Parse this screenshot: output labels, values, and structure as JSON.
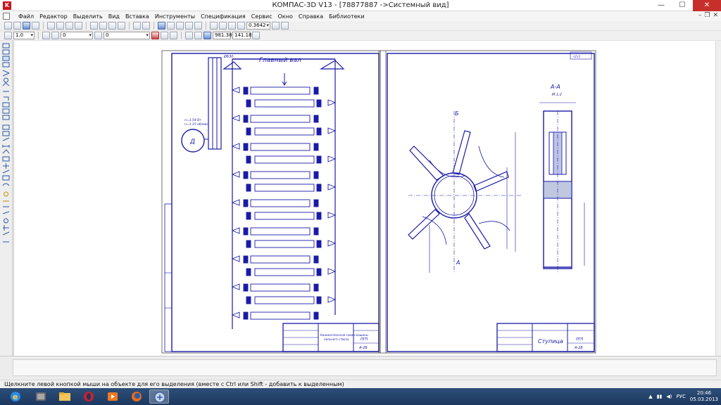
{
  "window": {
    "title": "КОМПАС-3D V13 - [78877887 ->Системный вид]",
    "minimize": "—",
    "maximize": "☐",
    "close": "✕",
    "app_icon": "K"
  },
  "menu": {
    "items": [
      "Файл",
      "Редактор",
      "Выделить",
      "Вид",
      "Вставка",
      "Инструменты",
      "Спецификация",
      "Сервис",
      "Окно",
      "Справка",
      "Библиотеки"
    ],
    "doc_controls": [
      "–",
      "❐",
      "✕"
    ]
  },
  "toolbar1": {
    "zoom_value": "0.3642"
  },
  "toolbar2": {
    "scale_value": "1.0",
    "style_value": "0",
    "layer_value": "0",
    "coord_x": "981.38",
    "coord_y": "141.18"
  },
  "drawing_left": {
    "title": "Главный вал",
    "labels": [
      "Ø630",
      "Д",
      "n=3.54 Вт",
      "n=1.15 об/мин"
    ],
    "stamp_title_1": "Кинематическая схема машины",
    "stamp_title_2": "пильного ствола",
    "stamp_code_1": "ПГП",
    "stamp_code_2": "А-2Б"
  },
  "drawing_right": {
    "section_label": "А-А",
    "section_scale": "М 1:2",
    "mark_top": "Б",
    "mark_bottom": "А",
    "stamp_title": "Ступица",
    "stamp_code_1": "ПГП",
    "stamp_code_2": "А-2Б",
    "roughness": "√(√)"
  },
  "status": {
    "hint": "Щелкните левой кнопкой мыши на объекте для его выделения (вместе с Ctrl или Shift - добавить к выделенным)"
  },
  "taskbar": {
    "lang": "РУС",
    "time": "20:46",
    "date": "05.03.2013"
  },
  "colors": {
    "drawing_blue": "#1a1aa8",
    "title_red": "#c8161d",
    "taskbar": "#1c3860"
  }
}
